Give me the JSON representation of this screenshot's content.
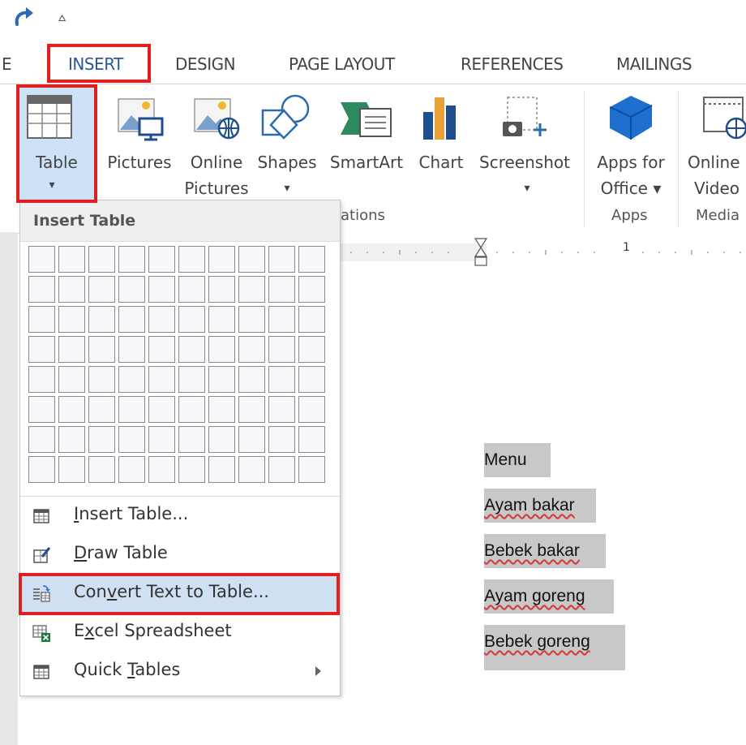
{
  "qat": {
    "redo_icon": "redo-icon",
    "more": "⩟"
  },
  "tabs": [
    {
      "label": "E"
    },
    {
      "label": "INSERT"
    },
    {
      "label": "DESIGN"
    },
    {
      "label": "PAGE LAYOUT"
    },
    {
      "label": "REFERENCES"
    },
    {
      "label": "MAILINGS"
    }
  ],
  "ribbon": {
    "table": {
      "label": "Table",
      "caret": "▾"
    },
    "pictures": {
      "label": "Pictures"
    },
    "online_pictures": {
      "label1": "Online",
      "label2": "Pictures"
    },
    "shapes": {
      "label": "Shapes",
      "caret": "▾"
    },
    "smartart": {
      "label": "SmartArt"
    },
    "chart": {
      "label": "Chart"
    },
    "screenshot": {
      "label": "Screenshot",
      "caret": "▾"
    },
    "apps_for_office": {
      "label1": "Apps for",
      "label2": "Office ▾"
    },
    "online_video": {
      "label1": "Online",
      "label2": "Video"
    },
    "groups": {
      "illustrations_partial": "ations",
      "apps": "Apps",
      "media": "Media"
    }
  },
  "ruler": {
    "mark": "1"
  },
  "dropdown": {
    "title": "Insert Table",
    "grid": {
      "cols": 10,
      "rows": 8
    },
    "items": [
      {
        "pre": "",
        "key": "I",
        "post": "nsert Table...",
        "icon": "table-grid-icon"
      },
      {
        "pre": "",
        "key": "D",
        "post": "raw Table",
        "icon": "draw-table-icon"
      },
      {
        "pre": "Con",
        "key": "v",
        "post": "ert Text to Table...",
        "icon": "convert-text-icon"
      },
      {
        "pre": "E",
        "key": "x",
        "post": "cel Spreadsheet",
        "icon": "excel-icon"
      },
      {
        "pre": "Quick ",
        "key": "T",
        "post": "ables",
        "icon": "quick-tables-icon"
      }
    ]
  },
  "document": {
    "lines": [
      {
        "text": "Menu",
        "spell_error": false
      },
      {
        "text": "Ayam bakar",
        "spell_error": true
      },
      {
        "text": "Bebek bakar",
        "spell_error": true
      },
      {
        "text": "Ayam goreng",
        "spell_error": true
      },
      {
        "text": "Bebek goreng",
        "spell_error": true
      }
    ]
  },
  "colors": {
    "accent": "#2b5797",
    "highlight_box": "#e02020",
    "selection": "#c8c8c8",
    "menu_hover": "#cfe0f3"
  }
}
